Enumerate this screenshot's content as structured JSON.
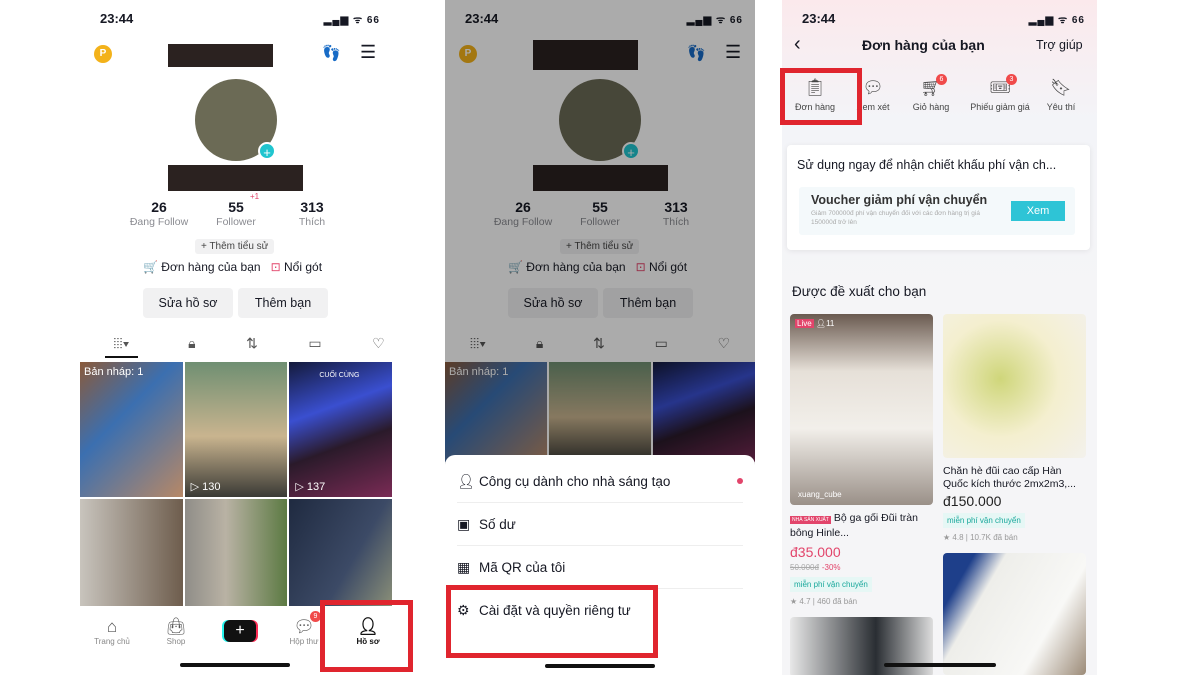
{
  "panel1": {
    "status": {
      "time": "23:44",
      "signal": "▂▄▆ ᯤ 66"
    },
    "coin_label": "P",
    "stats": [
      {
        "value": "26",
        "label": "Đang Follow"
      },
      {
        "value": "55",
        "label": "Follower",
        "badge": "+1"
      },
      {
        "value": "313",
        "label": "Thích"
      }
    ],
    "bio_chip": "+ Thêm tiểu sử",
    "orders_link": "Đơn hàng của bạn",
    "promote_link": "Nổi gót",
    "edit_button": "Sửa hồ sơ",
    "add_friend_button": "Thêm bạn",
    "grid": [
      {
        "label": "Bản nháp: 1"
      },
      {
        "views": "130"
      },
      {
        "views": "137",
        "caption": "CUỐI CÙNG"
      },
      {},
      {},
      {}
    ],
    "nav": [
      {
        "label": "Trang chủ",
        "icon": "home-icon"
      },
      {
        "label": "Shop",
        "icon": "bag-icon"
      },
      {
        "label": "+",
        "icon": "plus-icon"
      },
      {
        "label": "Hộp thư",
        "icon": "inbox-icon",
        "badge": "9"
      },
      {
        "label": "Hồ sơ",
        "icon": "profile-icon",
        "active": true
      }
    ]
  },
  "panel2": {
    "menu": [
      {
        "label": "Công cụ dành cho nhà sáng tạo",
        "icon": "creator-icon"
      },
      {
        "label": "Số dư",
        "icon": "wallet-icon"
      },
      {
        "label": "Mã QR của tôi",
        "icon": "qr-icon"
      },
      {
        "label": "Cài đặt và quyền riêng tư",
        "icon": "settings-icon"
      }
    ]
  },
  "panel3": {
    "title": "Đơn hàng của bạn",
    "help": "Trợ giúp",
    "shortcuts": [
      {
        "label": "Đơn hàng",
        "icon": "orders-icon"
      },
      {
        "label": "Xem xét",
        "icon": "review-icon"
      },
      {
        "label": "Giỏ hàng",
        "icon": "cart-icon",
        "badge": "6"
      },
      {
        "label": "Phiếu giảm giá",
        "icon": "coupon-icon",
        "badge": "3"
      },
      {
        "label": "Yêu thí",
        "icon": "bookmark-icon"
      }
    ],
    "promo_heading": "Sử dụng ngay để nhận chiết khấu phí vận ch...",
    "voucher_title": "Voucher giảm phí vận chuyển",
    "voucher_desc": "Giảm 700000đ phí vận chuyển đối với các đơn hàng trị giá 150000đ trở lên",
    "voucher_button": "Xem",
    "recommend_heading": "Được đề xuất cho bạn",
    "products": [
      {
        "live_viewers": "11",
        "seller": "xuang_cube",
        "tag": "NHÀ SẢN XUẤT",
        "name": "Bộ ga gối Đũi tràn bông Hinle...",
        "price": "đ35.000",
        "old_price": "50.000đ",
        "discount": "-30%",
        "shipping": "miễn phí vận chuyển",
        "rating": "4.7",
        "sold": "460 đã bán"
      },
      {
        "name": "Chăn hè đũi cao cấp Hàn Quốc kích thước 2mx2m3,...",
        "price": "đ150.000",
        "shipping": "miễn phí vận chuyển",
        "rating": "4.8",
        "sold": "10.7K đã bán"
      }
    ]
  },
  "colors": {
    "highlight": "#e0252e",
    "accent": "#e2456b",
    "teal": "#20c5cf"
  }
}
